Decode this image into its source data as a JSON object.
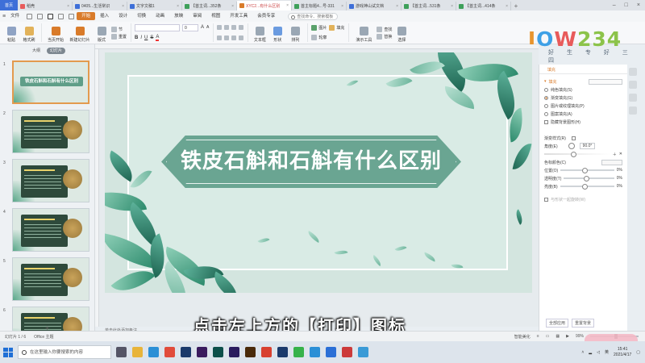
{
  "tabs": {
    "home": "首页",
    "docs": [
      {
        "label": "稻壳",
        "color": "#e85b5b"
      },
      {
        "label": "0405...生活常识",
        "color": "#3e6fd8"
      },
      {
        "label": "文字文稿1",
        "color": "#3e6fd8"
      },
      {
        "label": "【首主词...352条",
        "color": "#3ea05a"
      },
      {
        "label": "XYC2...有什么区别",
        "color": "#d97b2a",
        "active": true
      },
      {
        "label": "首主标题4...号-331",
        "color": "#3ea05a"
      },
      {
        "label": "游戏神山试文档",
        "color": "#3e6fd8"
      },
      {
        "label": "【首主词...531条",
        "color": "#3ea05a"
      },
      {
        "label": "【首主词...414条",
        "color": "#3ea05a"
      }
    ],
    "add": "+"
  },
  "menu": {
    "file": "文件",
    "items": [
      "开始",
      "插入",
      "设计",
      "切换",
      "动画",
      "放映",
      "审阅",
      "视图",
      "开发工具",
      "会员专享"
    ],
    "search_placeholder": "查找命令、搜索模板"
  },
  "ribbon": {
    "paste": "粘贴",
    "format_painter": "格式刷",
    "from_current": "当页开始",
    "new_slide": "新建幻灯片",
    "layout": "版式",
    "section": "节",
    "reset": "重置",
    "font_value": "",
    "size_value": "0",
    "textbox": "文本框",
    "shape": "形状",
    "arrange": "排列",
    "picture": "图片",
    "fill": "填充",
    "outline": "轮廓",
    "tools": "演示工具",
    "find": "查找",
    "replace": "替换",
    "select": "选择"
  },
  "logo": {
    "chars": [
      "J",
      "O",
      "W",
      "234"
    ],
    "sub": "好 生 专 好 三 四"
  },
  "left_pane": {
    "tabs": [
      "大纲",
      "幻灯片"
    ],
    "selected_tab": "幻灯片",
    "slides": [
      {
        "num": "1",
        "title": "铁皮石斛和石斛有什么区别"
      },
      {
        "num": "2"
      },
      {
        "num": "3"
      },
      {
        "num": "4"
      },
      {
        "num": "5"
      },
      {
        "num": "6"
      }
    ],
    "add": "+"
  },
  "slide": {
    "title": "铁皮石斛和石斛有什么区别"
  },
  "notes_placeholder": "单击此处添加备注",
  "right_panel": {
    "header": "填充",
    "section": "填充",
    "options": [
      "纯色填充(S)",
      "渐变填充(G)",
      "图片或纹理填充(P)",
      "图案填充(A)"
    ],
    "selected": "渐变填充(G)",
    "hide_bg": "隐藏背景图形(H)",
    "gradient_style": "渐变样式(R)",
    "angle_label": "角度(E)",
    "angle_value": "90.0°",
    "color_label": "色标颜色(C)",
    "position_label": "位置(O)",
    "position_value": "0%",
    "transparency_label": "透明度(T)",
    "transparency_value": "0%",
    "brightness_label": "亮度(B)",
    "brightness_value": "0%",
    "rotate_with_shape": "与形状一起旋转(W)",
    "apply_all": "全部应用",
    "reset_bg": "重置背景"
  },
  "subtitle": "点击左上方的【打印】图标",
  "status": {
    "slide_count": "幻灯片 1 / 6",
    "theme": "Office 主题",
    "smart_beautify": "智能美化",
    "zoom": "99%"
  },
  "taskbar": {
    "search_placeholder": "在这里输入你要搜索的内容",
    "time": "15:41",
    "date": "2021/4/17",
    "lang": "英"
  }
}
